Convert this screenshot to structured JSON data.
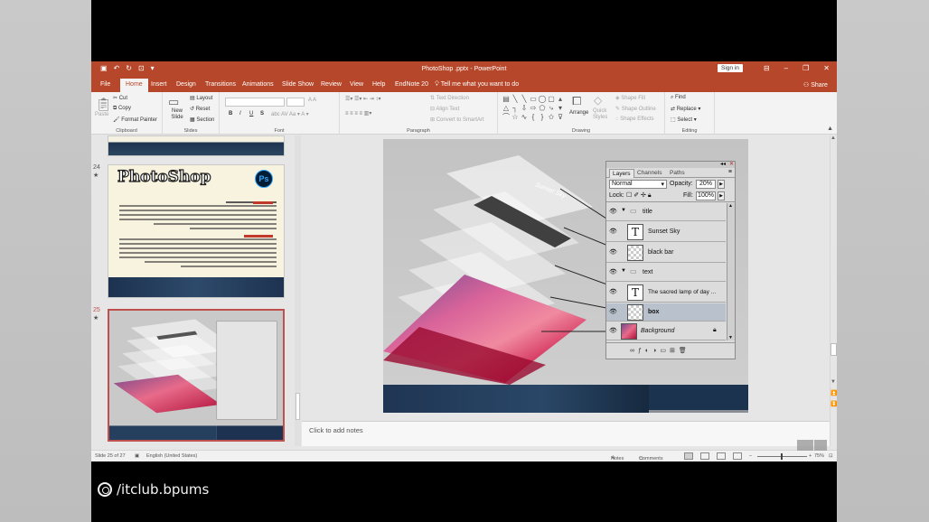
{
  "app": {
    "title": "PhotoShop .pptx  -  PowerPoint",
    "signin": "Sign in",
    "tabs": [
      "File",
      "Home",
      "Insert",
      "Design",
      "Transitions",
      "Animations",
      "Slide Show",
      "Review",
      "View",
      "Help",
      "EndNote 20"
    ],
    "active_tab": "Home",
    "tell_me": "Tell me what you want to do",
    "share": "Share",
    "accent": "#b7472a"
  },
  "ribbon": {
    "clipboard": {
      "paste": "Paste",
      "cut": "Cut",
      "copy": "Copy",
      "format_painter": "Format Painter",
      "label": "Clipboard"
    },
    "slides": {
      "new_slide": "New Slide",
      "layout": "Layout",
      "reset": "Reset",
      "section": "Section",
      "label": "Slides"
    },
    "font": {
      "label": "Font",
      "bold": "B",
      "italic": "I",
      "underline": "U",
      "strike": "S"
    },
    "paragraph": {
      "text_direction": "Text Direction",
      "align_text": "Align Text",
      "convert_smartart": "Convert to SmartArt",
      "label": "Paragraph"
    },
    "drawing": {
      "arrange": "Arrange",
      "quick_styles": "Quick Styles",
      "shape_fill": "Shape Fill",
      "shape_outline": "Shape Outline",
      "shape_effects": "Shape Effects",
      "label": "Drawing"
    },
    "editing": {
      "find": "Find",
      "replace": "Replace",
      "select": "Select",
      "label": "Editing"
    }
  },
  "thumbnails": {
    "slide24": {
      "number": "24",
      "title": "PhotoShop",
      "ps_logo": "Ps"
    },
    "slide25": {
      "number": "25"
    }
  },
  "slide": {
    "layer_title_text": "Sunset Sky",
    "panel": {
      "tabs": [
        "Layers",
        "Channels",
        "Paths"
      ],
      "blend_mode": "Normal",
      "opacity_label": "Opacity:",
      "opacity_value": "20%",
      "lock_label": "Lock:",
      "fill_label": "Fill:",
      "fill_value": "100%",
      "layers": [
        {
          "name": "title",
          "kind": "group"
        },
        {
          "name": "Sunset Sky",
          "kind": "text"
        },
        {
          "name": "black bar",
          "kind": "fill"
        },
        {
          "name": "text",
          "kind": "group"
        },
        {
          "name": "The sacred lamp of day ...",
          "kind": "text"
        },
        {
          "name": "box",
          "kind": "fill",
          "selected": true
        },
        {
          "name": "Background",
          "kind": "image"
        }
      ]
    }
  },
  "notes_placeholder": "Click to add notes",
  "status": {
    "slide_of": "Slide 25 of 27",
    "language": "English (United States)",
    "notes": "Notes",
    "comments": "Comments",
    "zoom": "75%"
  },
  "watermark": "/itclub.bpums"
}
